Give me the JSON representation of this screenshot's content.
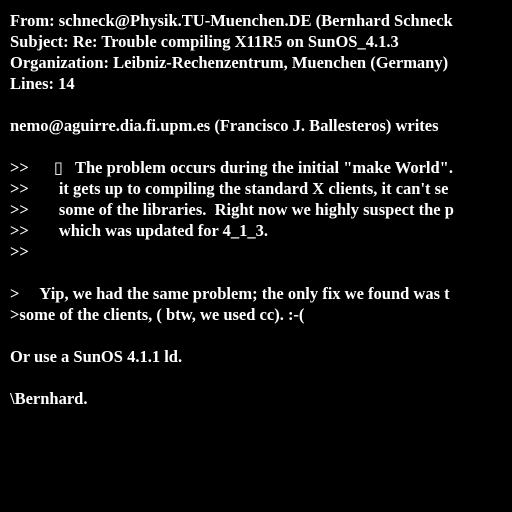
{
  "header": {
    "from": "From: schneck@Physik.TU-Muenchen.DE (Bernhard Schneck",
    "subject": "Subject: Re: Trouble compiling X11R5 on SunOS_4.1.3",
    "organization": "Organization: Leibniz-Rechenzentrum, Muenchen (Germany)",
    "lines": "Lines: 14"
  },
  "body": {
    "attribution": "nemo@aguirre.dia.fi.upm.es (Francisco J. Ballesteros) writes",
    "quote2": [
      {
        "prefix": ">>",
        "text": "▯   The problem occurs during the initial \"make World\"."
      },
      {
        "prefix": ">>",
        "text": "it gets up to compiling the standard X clients, it can't se"
      },
      {
        "prefix": ">>",
        "text": "some of the libraries.  Right now we highly suspect the p"
      },
      {
        "prefix": ">>",
        "text": "which was updated for 4_1_3."
      },
      {
        "prefix": ">>",
        "text": ""
      }
    ],
    "quote1": [
      {
        "prefix": ">",
        "text": "Yip, we had the same problem; the only fix we found was t"
      },
      {
        "prefix": ">some of the clients, ( btw, we used cc). :-(",
        "text": ""
      }
    ],
    "reply": "Or use a SunOS 4.1.1 ld.",
    "signature": "\\Bernhard."
  }
}
